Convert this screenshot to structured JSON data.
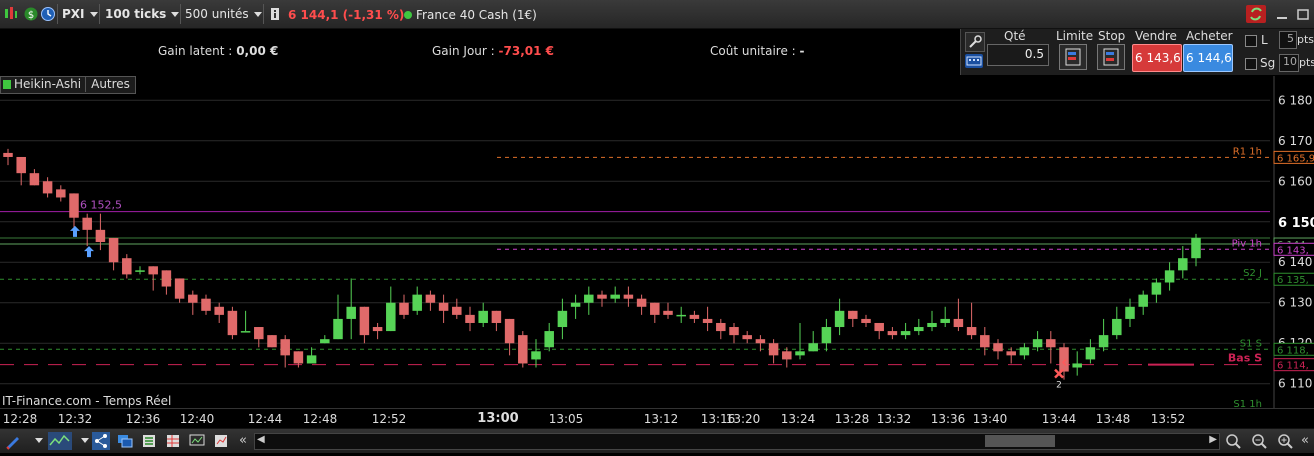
{
  "toolbar": {
    "symbol_menu": "PXI",
    "timeframe": "100 ticks",
    "units": "500 unités",
    "price_change": "6 144,1 (-1,31 %)",
    "instrument": "France 40 Cash (1€)",
    "colors": {
      "negative": "#ff4d4d",
      "live_dot": "#3fc63f"
    }
  },
  "info": {
    "gain_latent_label": "Gain latent :",
    "gain_latent_value": "0,00 €",
    "gain_jour_label": "Gain Jour :",
    "gain_jour_value": "-73,01 €",
    "cout_label": "Coût unitaire :",
    "cout_value": "-"
  },
  "order_panel": {
    "qty_label": "Qté",
    "qty_value": "0.5",
    "limit_label": "Limite",
    "stop_label": "Stop",
    "sell_label": "Vendre",
    "sell_price": "6 143,6",
    "buy_label": "Acheter",
    "buy_price": "6 144,6",
    "chk_l": "L",
    "chk_sg": "Sg",
    "pts1_value": "5",
    "pts2_value": "10",
    "pts1_unit": "pts",
    "pts2_unit": "pts"
  },
  "indicator_tabs": {
    "first": "Heikin-Ashi",
    "second": "Autres"
  },
  "watermark": "IT-Finance.com - Temps Réel",
  "chart_data": {
    "type": "candlestick",
    "style": "Heikin-Ashi",
    "ylim": [
      6104,
      6186
    ],
    "yticks": [
      "6 180",
      "6 170",
      "6 160",
      "6 150",
      "6 140",
      "6 130",
      "6 120",
      "6 110"
    ],
    "xticks": [
      "12:28",
      "12:32",
      "12:36",
      "12:40",
      "12:44",
      "12:48",
      "12:52",
      "13:00",
      "13:05",
      "13:12",
      "13:16",
      "13:20",
      "13:24",
      "13:28",
      "13:32",
      "13:36",
      "13:40",
      "13:44",
      "13:48",
      "13:52"
    ],
    "candles": [
      [
        6167,
        6166,
        6168,
        6164
      ],
      [
        6166,
        6162,
        6166,
        6159
      ],
      [
        6162,
        6159,
        6163,
        6159
      ],
      [
        6160,
        6157,
        6161,
        6156
      ],
      [
        6158,
        6156,
        6159,
        6155
      ],
      [
        6157,
        6151,
        6157,
        6148
      ],
      [
        6151,
        6148,
        6152,
        6144
      ],
      [
        6148,
        6145,
        6152,
        6143
      ],
      [
        6146,
        6140,
        6146,
        6138
      ],
      [
        6141,
        6137,
        6142,
        6136
      ],
      [
        6138,
        6138,
        6139,
        6137
      ],
      [
        6139,
        6137,
        6139,
        6133
      ],
      [
        6138,
        6134,
        6138,
        6132
      ],
      [
        6136,
        6131,
        6136,
        6130
      ],
      [
        6132,
        6130,
        6133,
        6127
      ],
      [
        6131,
        6128,
        6132,
        6127
      ],
      [
        6129,
        6127,
        6130,
        6125
      ],
      [
        6128,
        6122,
        6129,
        6121
      ],
      [
        6123,
        6123,
        6128,
        6123
      ],
      [
        6124,
        6121,
        6124,
        6119
      ],
      [
        6122,
        6119,
        6122,
        6119
      ],
      [
        6121,
        6117,
        6122,
        6114
      ],
      [
        6118,
        6115,
        6118,
        6114
      ],
      [
        6115,
        6117,
        6116,
        6119
      ],
      [
        6120,
        6121,
        6122,
        6120
      ],
      [
        6121,
        6126,
        6132,
        6121
      ],
      [
        6126,
        6129,
        6136,
        6121
      ],
      [
        6129,
        6122,
        6129,
        6120
      ],
      [
        6124,
        6123,
        6125,
        6121
      ],
      [
        6123,
        6130,
        6134,
        6123
      ],
      [
        6130,
        6127,
        6132,
        6126
      ],
      [
        6128,
        6132,
        6134,
        6127
      ],
      [
        6132,
        6130,
        6133,
        6128
      ],
      [
        6130,
        6128,
        6132,
        6125
      ],
      [
        6129,
        6127,
        6131,
        6126
      ],
      [
        6127,
        6125,
        6129,
        6123
      ],
      [
        6125,
        6128,
        6130,
        6124
      ],
      [
        6128,
        6125,
        6128,
        6123
      ],
      [
        6126,
        6120,
        6126,
        6117
      ],
      [
        6122,
        6115,
        6123,
        6114
      ],
      [
        6116,
        6118,
        6121,
        6114
      ],
      [
        6119,
        6123,
        6125,
        6118
      ],
      [
        6124,
        6128,
        6131,
        6121
      ],
      [
        6129,
        6130,
        6132,
        6126
      ],
      [
        6130,
        6132,
        6134,
        6127
      ],
      [
        6132,
        6131,
        6133,
        6129
      ],
      [
        6131,
        6132,
        6134,
        6130
      ],
      [
        6132,
        6131,
        6134,
        6129
      ],
      [
        6131,
        6129,
        6132,
        6127
      ],
      [
        6130,
        6127,
        6130,
        6125
      ],
      [
        6128,
        6127,
        6130,
        6126
      ],
      [
        6127,
        6127,
        6129,
        6125
      ],
      [
        6127,
        6126,
        6128,
        6125
      ],
      [
        6126,
        6125,
        6129,
        6123
      ],
      [
        6125,
        6123,
        6126,
        6121
      ],
      [
        6124,
        6122,
        6125,
        6120
      ],
      [
        6122,
        6121,
        6123,
        6120
      ],
      [
        6121,
        6120,
        6122,
        6118
      ],
      [
        6120,
        6117,
        6121,
        6115
      ],
      [
        6118,
        6116,
        6119,
        6114
      ],
      [
        6117,
        6118,
        6125,
        6116
      ],
      [
        6118,
        6120,
        6123,
        6118
      ],
      [
        6120,
        6124,
        6126,
        6118
      ],
      [
        6124,
        6128,
        6131,
        6122
      ],
      [
        6128,
        6126,
        6128,
        6124
      ],
      [
        6126,
        6125,
        6127,
        6124
      ],
      [
        6125,
        6123,
        6125,
        6121
      ],
      [
        6123,
        6122,
        6124,
        6121
      ],
      [
        6122,
        6123,
        6125,
        6121
      ],
      [
        6123,
        6124,
        6126,
        6122
      ],
      [
        6124,
        6125,
        6128,
        6123
      ],
      [
        6125,
        6126,
        6129,
        6124
      ],
      [
        6126,
        6124,
        6131,
        6123
      ],
      [
        6124,
        6122,
        6130,
        6121
      ],
      [
        6122,
        6119,
        6124,
        6117
      ],
      [
        6120,
        6118,
        6121,
        6116
      ],
      [
        6118,
        6117,
        6119,
        6115
      ],
      [
        6117,
        6119,
        6120,
        6116
      ],
      [
        6119,
        6121,
        6123,
        6118
      ],
      [
        6121,
        6119,
        6123,
        6115
      ],
      [
        6119,
        6113,
        6120,
        6111
      ],
      [
        6114,
        6115,
        6118,
        6112
      ],
      [
        6116,
        6119,
        6121,
        6115
      ],
      [
        6119,
        6122,
        6126,
        6118
      ],
      [
        6122,
        6126,
        6129,
        6121
      ],
      [
        6126,
        6129,
        6131,
        6124
      ],
      [
        6129,
        6132,
        6133,
        6127
      ],
      [
        6132,
        6135,
        6136,
        6130
      ],
      [
        6135,
        6138,
        6140,
        6133
      ],
      [
        6138,
        6141,
        6144,
        6136
      ],
      [
        6141,
        6146,
        6147,
        6139
      ]
    ],
    "candle_format": "[open, close, high, low]",
    "levels": [
      {
        "name": "R1 1h",
        "value": 6165.9,
        "color": "#e0702a",
        "style": "dashed",
        "label": "6 165,9"
      },
      {
        "name": "",
        "value": 6152.5,
        "color": "#a21ea8",
        "style": "solid",
        "label": ""
      },
      {
        "name": "",
        "value": 6144.5,
        "color": "#5fa55f",
        "style": "solid",
        "label": "6 144,"
      },
      {
        "name": "Piv 1h",
        "value": 6143.2,
        "color": "#cc44cc",
        "style": "dashed",
        "label": "6 143,"
      },
      {
        "name": "S2 J",
        "value": 6135.8,
        "color": "#2f8f2f",
        "style": "dashed",
        "label": "6 135,"
      },
      {
        "name": "S1 S",
        "value": 6118.5,
        "color": "#2f8f2f",
        "style": "dashed",
        "label": "6 118,"
      },
      {
        "name": "Bas S",
        "value": 6114.7,
        "color": "#cc2255",
        "style": "longdash",
        "label": "6 114,"
      }
    ],
    "price_marker": {
      "text": "6 152,5",
      "color": "#b050c0"
    },
    "last_price": {
      "value": "6 150",
      "color": "#ffffff"
    },
    "marker_count": "2",
    "s1h_label": "S1 1h"
  }
}
